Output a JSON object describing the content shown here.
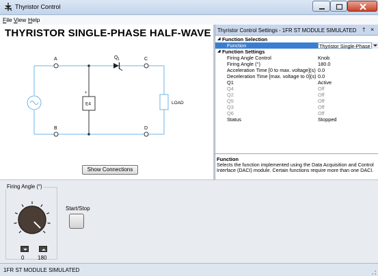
{
  "window": {
    "title": "Thyristor Control"
  },
  "menu": {
    "file": "File",
    "view": "View",
    "help": "Help"
  },
  "diagram": {
    "title": "THYRISTOR SINGLE-PHASE HALF-WAVE REC",
    "nodes": {
      "a": "A",
      "b": "B",
      "c": "C",
      "d": "D"
    },
    "q1_label": "Q",
    "q1_sub": "1",
    "e4_label": "E4",
    "e4_plus": "+",
    "load_label": "LOAD",
    "show_connections": "Show Connections"
  },
  "settings": {
    "header_title": "Thyristor Control Settings - 1FR ST MODULE SIMULATED",
    "pin_glyph": "†",
    "close_glyph": "×",
    "categories": {
      "selection": "Function Selection",
      "settings": "Function Settings"
    },
    "rows": [
      {
        "key": "Function",
        "value": "Thyristor Single-Phase Ha"
      },
      {
        "key": "Firing Angle Control",
        "value": "Knob"
      },
      {
        "key": "Firing Angle (°)",
        "value": "180.0"
      },
      {
        "key": "Acceleration Time [0 to max. voltage](s)",
        "value": "0.0"
      },
      {
        "key": "Deceleration Time [max. voltage to 0](s)",
        "value": "0.0"
      },
      {
        "key": "Q1",
        "value": "Active"
      },
      {
        "key": "Q4",
        "value": "Off"
      },
      {
        "key": "Q2",
        "value": "Off"
      },
      {
        "key": "Q5",
        "value": "Off"
      },
      {
        "key": "Q3",
        "value": "Off"
      },
      {
        "key": "Q6",
        "value": "Off"
      },
      {
        "key": "Status",
        "value": "Stopped"
      }
    ],
    "description": {
      "title": "Function",
      "text": "Selects the function implemented using the Data Acquisition and Control Interface (DACI) module. Certain functions require more than one DACI."
    }
  },
  "controls": {
    "firing_angle_label": "Firing Angle (°)",
    "min_value": "0",
    "max_value": "180",
    "knob_level": 1.0,
    "start_stop_label": "Start/Stop"
  },
  "status": {
    "text": "1FR ST MODULE SIMULATED"
  }
}
